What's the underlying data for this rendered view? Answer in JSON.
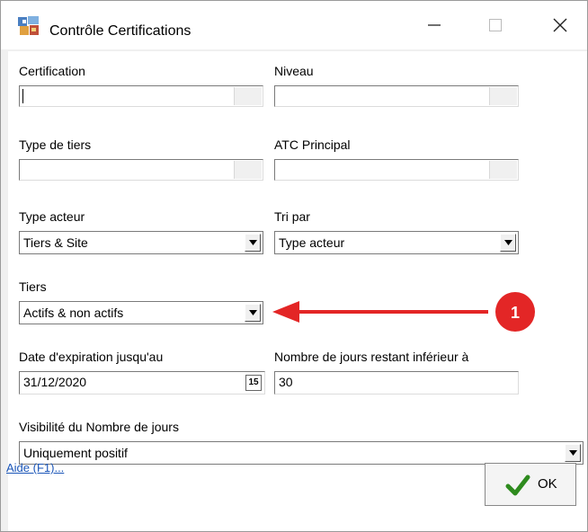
{
  "window": {
    "title": "Contrôle Certifications"
  },
  "fields": {
    "certification": {
      "label": "Certification",
      "value": ""
    },
    "niveau": {
      "label": "Niveau",
      "value": ""
    },
    "type_tiers": {
      "label": "Type de tiers",
      "value": ""
    },
    "atc_principal": {
      "label": "ATC Principal",
      "value": ""
    },
    "type_acteur": {
      "label": "Type acteur",
      "value": "Tiers & Site"
    },
    "tri_par": {
      "label": "Tri par",
      "value": "Type acteur"
    },
    "tiers": {
      "label": "Tiers",
      "value": "Actifs & non actifs"
    },
    "date_expiration": {
      "label": "Date d'expiration jusqu'au",
      "value": "31/12/2020",
      "calendar_glyph": "15"
    },
    "nombre_jours": {
      "label": "Nombre de jours restant inférieur à",
      "value": "30"
    },
    "visibilite": {
      "label": "Visibilité du Nombre de jours",
      "value": "Uniquement positif"
    }
  },
  "footer": {
    "help_link": "Aide (F1)...",
    "ok_label": "OK"
  },
  "annotation": {
    "badge_number": "1",
    "color": "#e32626"
  },
  "colors": {
    "check": "#2e8b1e",
    "link": "#1a55b8"
  },
  "icons": [
    "app-icon",
    "minimize-icon",
    "maximize-icon",
    "close-icon",
    "dropdown-arrow-icon",
    "calendar-icon",
    "checkmark-icon"
  ]
}
